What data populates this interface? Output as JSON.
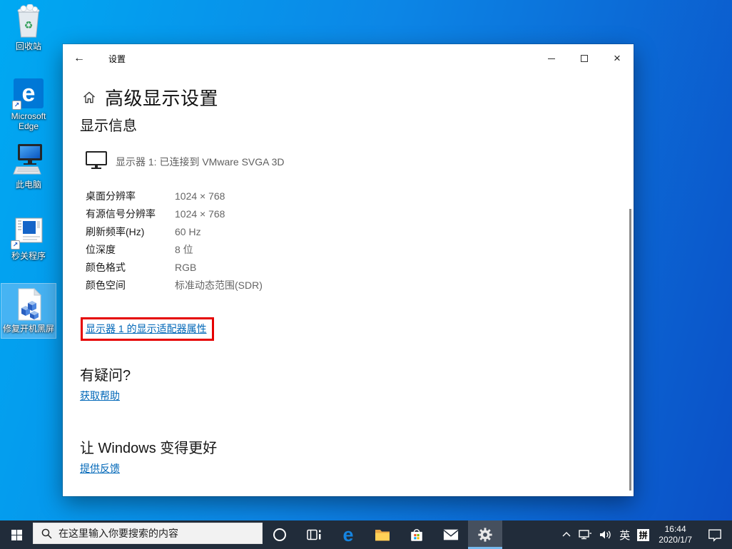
{
  "desktop": {
    "icons": [
      {
        "label": "回收站",
        "icon": "recycle-bin-icon"
      },
      {
        "label": "Microsoft Edge",
        "lines": [
          "Microsoft",
          "Edge"
        ],
        "icon": "edge-icon",
        "shortcut": true
      },
      {
        "label": "此电脑",
        "icon": "this-pc-icon"
      },
      {
        "label": "秒关程序",
        "icon": "app-window-icon",
        "shortcut": true
      },
      {
        "label": "修复开机黑屏",
        "icon": "registry-file-icon",
        "selected": true
      }
    ]
  },
  "window": {
    "titlebar": {
      "title": "设置",
      "back_glyph": "←",
      "close_glyph": "×"
    },
    "page": {
      "title": "高级显示设置",
      "section": "显示信息",
      "monitor_status": "显示器 1: 已连接到 VMware SVGA 3D",
      "properties": [
        {
          "label": "桌面分辨率",
          "value": "1024 × 768"
        },
        {
          "label": "有源信号分辨率",
          "value": "1024 × 768"
        },
        {
          "label": "刷新频率(Hz)",
          "value": "60 Hz"
        },
        {
          "label": "位深度",
          "value": "8 位"
        },
        {
          "label": "颜色格式",
          "value": "RGB"
        },
        {
          "label": "颜色空间",
          "value": "标准动态范围(SDR)"
        }
      ],
      "adapter_link": "显示器 1 的显示适配器属性",
      "help_heading": "有疑问?",
      "help_link": "获取帮助",
      "feedback_heading": "让 Windows 变得更好",
      "feedback_link": "提供反馈"
    }
  },
  "taskbar": {
    "search_placeholder": "在这里输入你要搜索的内容",
    "icons": [
      "start",
      "search",
      "cortana",
      "task-view",
      "edge",
      "file-explorer",
      "store",
      "mail",
      "settings"
    ],
    "active_app": "settings",
    "tray": {
      "lang_indicator": "英",
      "ime_indicator": "拼",
      "time": "16:44",
      "date": "2020/1/7"
    }
  },
  "colors": {
    "desktop_left": "#00a9f2",
    "desktop_right": "#0b4fc6",
    "accent": "#0078d7",
    "link_blue": "#0067b8",
    "highlight_red": "#e50000",
    "taskbar_bg": "#212c3a",
    "taskbar_underline": "#76b9ed",
    "value_gray": "#666666"
  }
}
